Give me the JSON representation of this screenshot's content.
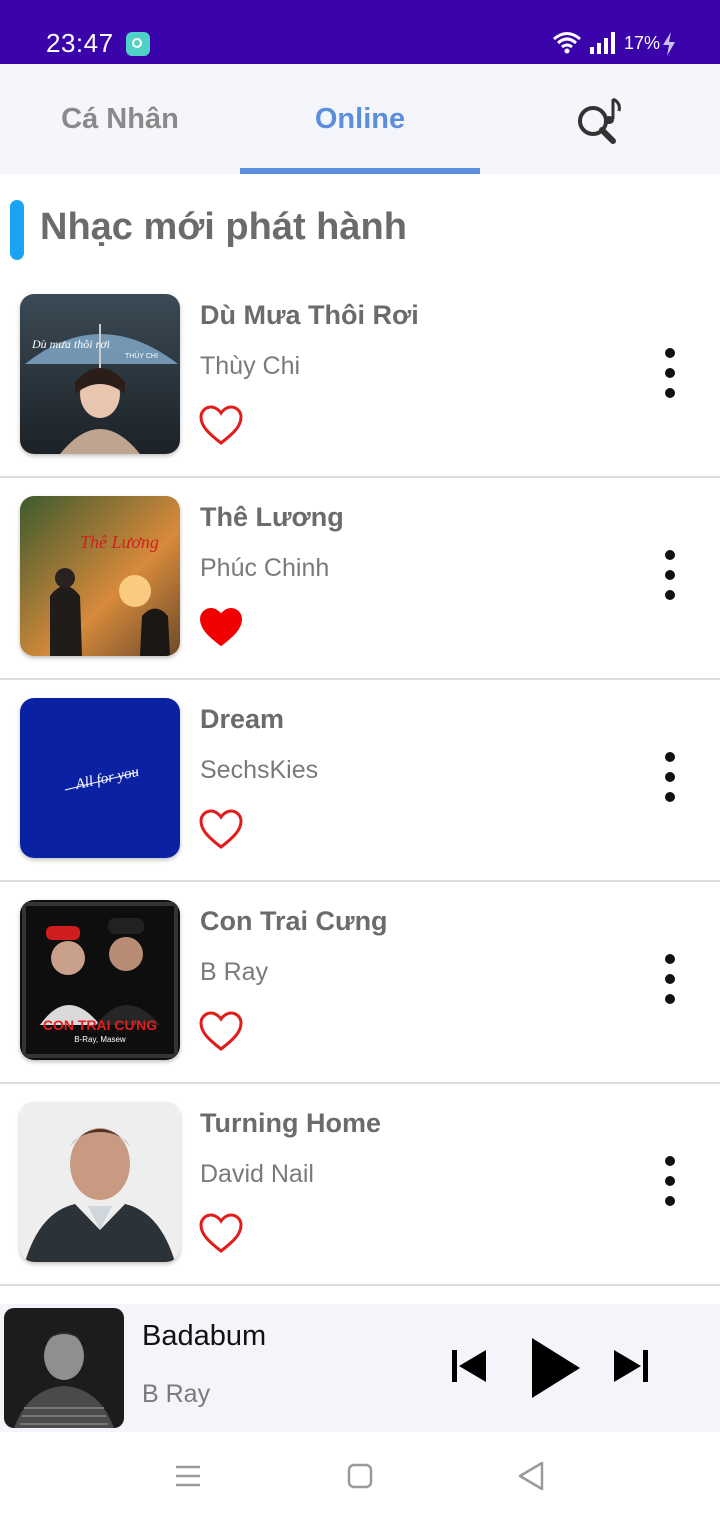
{
  "status_bar": {
    "time": "23:47",
    "battery": "17%"
  },
  "tabs": [
    {
      "label": "Cá Nhân",
      "active": false
    },
    {
      "label": "Online",
      "active": true
    },
    {
      "icon": "music-search-icon"
    }
  ],
  "section": {
    "title": "Nhạc mới phát hành"
  },
  "songs": [
    {
      "title": "Dù Mưa Thôi Rơi",
      "artist": "Thùy Chi",
      "liked": false,
      "cover_text": [
        "Dù mưa thôi rơi",
        "THÙY CHI"
      ]
    },
    {
      "title": "Thê Lương",
      "artist": "Phúc Chinh",
      "liked": true,
      "cover_text": [
        "Thê Lương"
      ]
    },
    {
      "title": "Dream",
      "artist": "SechsKies",
      "liked": false,
      "cover_text": [
        "All for you"
      ]
    },
    {
      "title": "Con Trai Cưng",
      "artist": "B Ray",
      "liked": false,
      "cover_text": [
        "CON TRAI CƯNG",
        "B-Ray, Masew"
      ]
    },
    {
      "title": "Turning Home",
      "artist": "David Nail",
      "liked": false
    }
  ],
  "player": {
    "title": "Badabum",
    "artist": "B Ray",
    "state": "paused"
  },
  "colors": {
    "status_bar": "#3a04aa",
    "accent": "#5b8fdc",
    "section_marker": "#1aa3f0",
    "heart": "#e21b1b"
  }
}
